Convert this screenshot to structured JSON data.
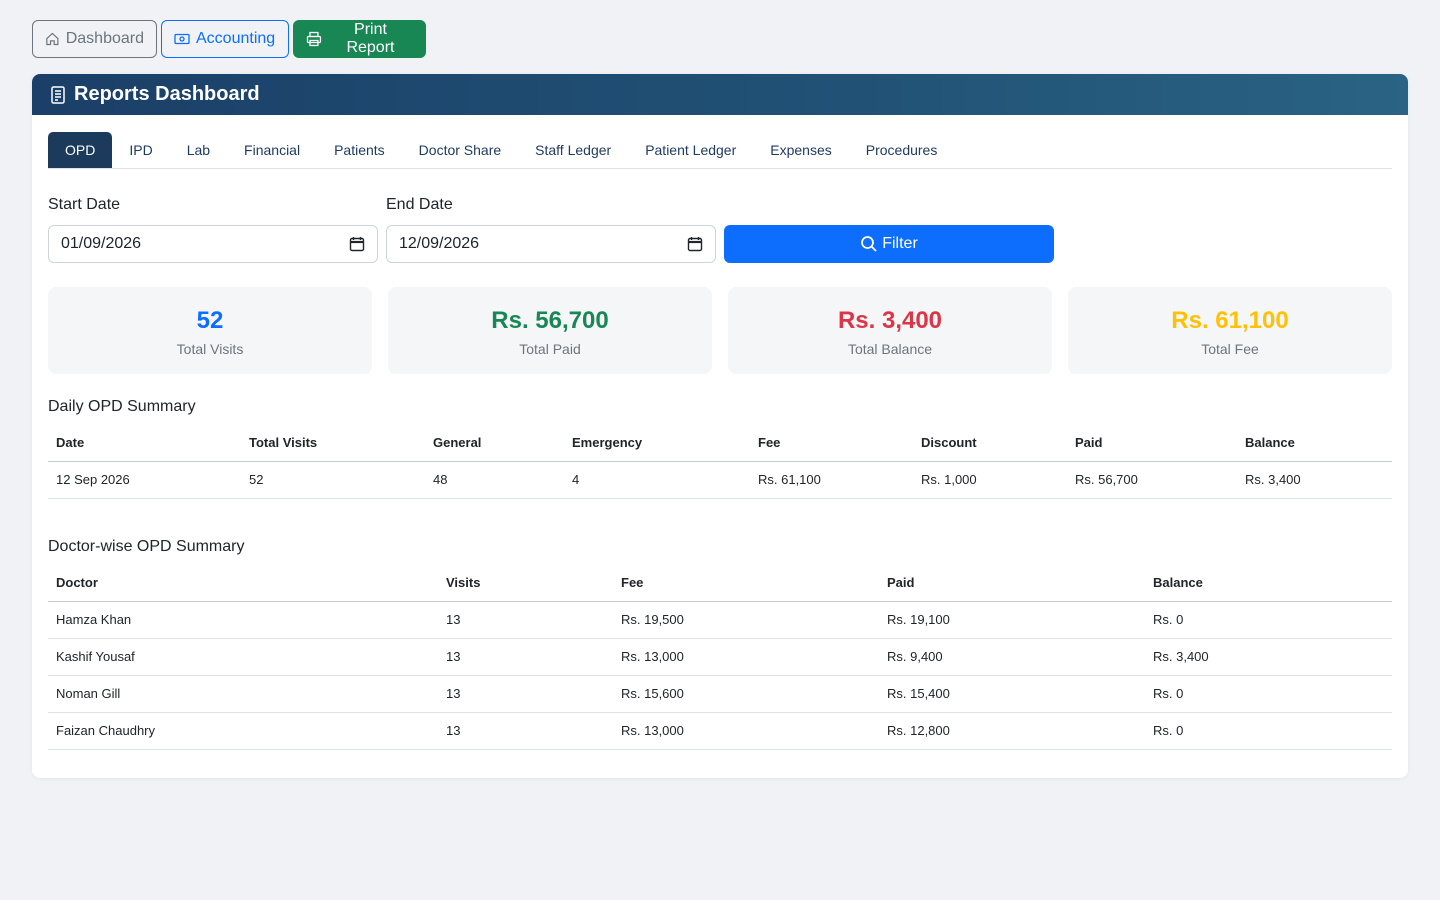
{
  "topbar": {
    "dashboard_label": "Dashboard",
    "accounting_label": "Accounting",
    "print_label": "Print Report"
  },
  "header": {
    "title": "Reports Dashboard"
  },
  "tabs": [
    "OPD",
    "IPD",
    "Lab",
    "Financial",
    "Patients",
    "Doctor Share",
    "Staff Ledger",
    "Patient Ledger",
    "Expenses",
    "Procedures"
  ],
  "active_tab": "OPD",
  "filters": {
    "start_label": "Start Date",
    "start_value": "01/09/2026",
    "end_label": "End Date",
    "end_value": "12/09/2026",
    "filter_label": "Filter"
  },
  "stats": [
    {
      "value": "52",
      "label": "Total Visits",
      "color": "#0d6efd"
    },
    {
      "value": "Rs. 56,700",
      "label": "Total Paid",
      "color": "#198754"
    },
    {
      "value": "Rs. 3,400",
      "label": "Total Balance",
      "color": "#dc3545"
    },
    {
      "value": "Rs. 61,100",
      "label": "Total Fee",
      "color": "#ffc107"
    }
  ],
  "daily": {
    "title": "Daily OPD Summary",
    "headers": [
      "Date",
      "Total Visits",
      "General",
      "Emergency",
      "Fee",
      "Discount",
      "Paid",
      "Balance"
    ],
    "rows": [
      [
        "12 Sep 2026",
        "52",
        "48",
        "4",
        "Rs. 61,100",
        "Rs. 1,000",
        "Rs. 56,700",
        "Rs. 3,400"
      ]
    ]
  },
  "doctor": {
    "title": "Doctor-wise OPD Summary",
    "headers": [
      "Doctor",
      "Visits",
      "Fee",
      "Paid",
      "Balance"
    ],
    "rows": [
      [
        "Hamza Khan",
        "13",
        "Rs. 19,500",
        "Rs. 19,100",
        "Rs. 0"
      ],
      [
        "Kashif Yousaf",
        "13",
        "Rs. 13,000",
        "Rs. 9,400",
        "Rs. 3,400"
      ],
      [
        "Noman Gill",
        "13",
        "Rs. 15,600",
        "Rs. 15,400",
        "Rs. 0"
      ],
      [
        "Faizan Chaudhry",
        "13",
        "Rs. 13,000",
        "Rs. 12,800",
        "Rs. 0"
      ]
    ]
  }
}
